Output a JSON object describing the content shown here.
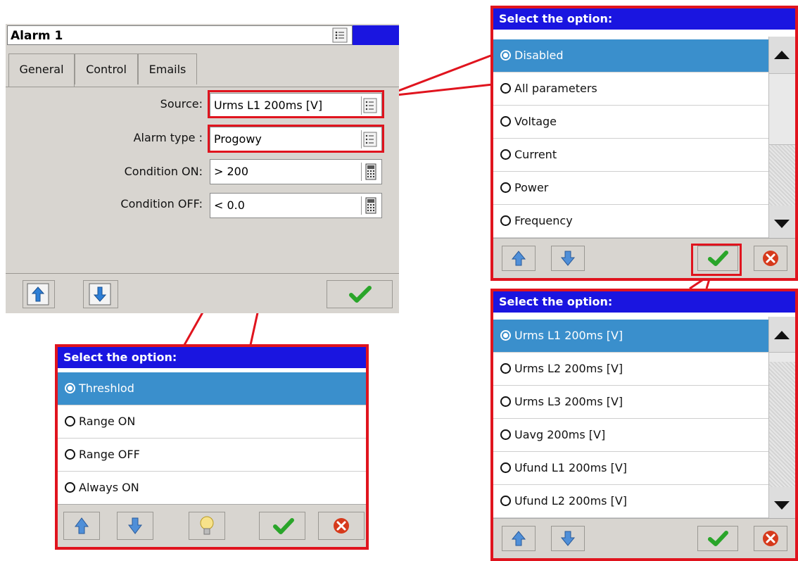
{
  "main_window": {
    "title": "Alarm 1",
    "tabs": [
      "General",
      "Control",
      "Emails"
    ],
    "fields": [
      {
        "label": "Source:",
        "value": "Urms L1 200ms [V]",
        "button": "list"
      },
      {
        "label": "Alarm type :",
        "value": "Progowy",
        "button": "list"
      },
      {
        "label": "Condition ON:",
        "value": "> 200",
        "button": "calculator"
      },
      {
        "label": "Condition OFF:",
        "value": "< 0.0",
        "button": "calculator"
      }
    ],
    "footer_buttons": [
      "arrow-up-icon",
      "arrow-down-icon",
      "checkmark-icon"
    ]
  },
  "dialog_source_category": {
    "title": "Select the option:",
    "options": [
      "Disabled",
      "All parameters",
      "Voltage",
      "Current",
      "Power",
      "Frequency"
    ],
    "selected": "Disabled"
  },
  "dialog_source_parameter": {
    "title": "Select the option:",
    "options": [
      "Urms L1 200ms [V]",
      "Urms L2 200ms [V]",
      "Urms L3 200ms [V]",
      "Uavg 200ms [V]",
      "Ufund L1 200ms [V]",
      "Ufund L2 200ms [V]"
    ],
    "selected": "Urms L1 200ms [V]"
  },
  "dialog_alarm_type": {
    "title": "Select the option:",
    "options": [
      "Threshlod",
      "Range ON",
      "Range OFF",
      "Always ON"
    ],
    "selected": "Threshlod"
  },
  "colors": {
    "title_blue": "#1a15e0",
    "selection_blue": "#3a8fcc",
    "callout_red": "#e0141e",
    "panel_gray": "#d8d5d0"
  }
}
